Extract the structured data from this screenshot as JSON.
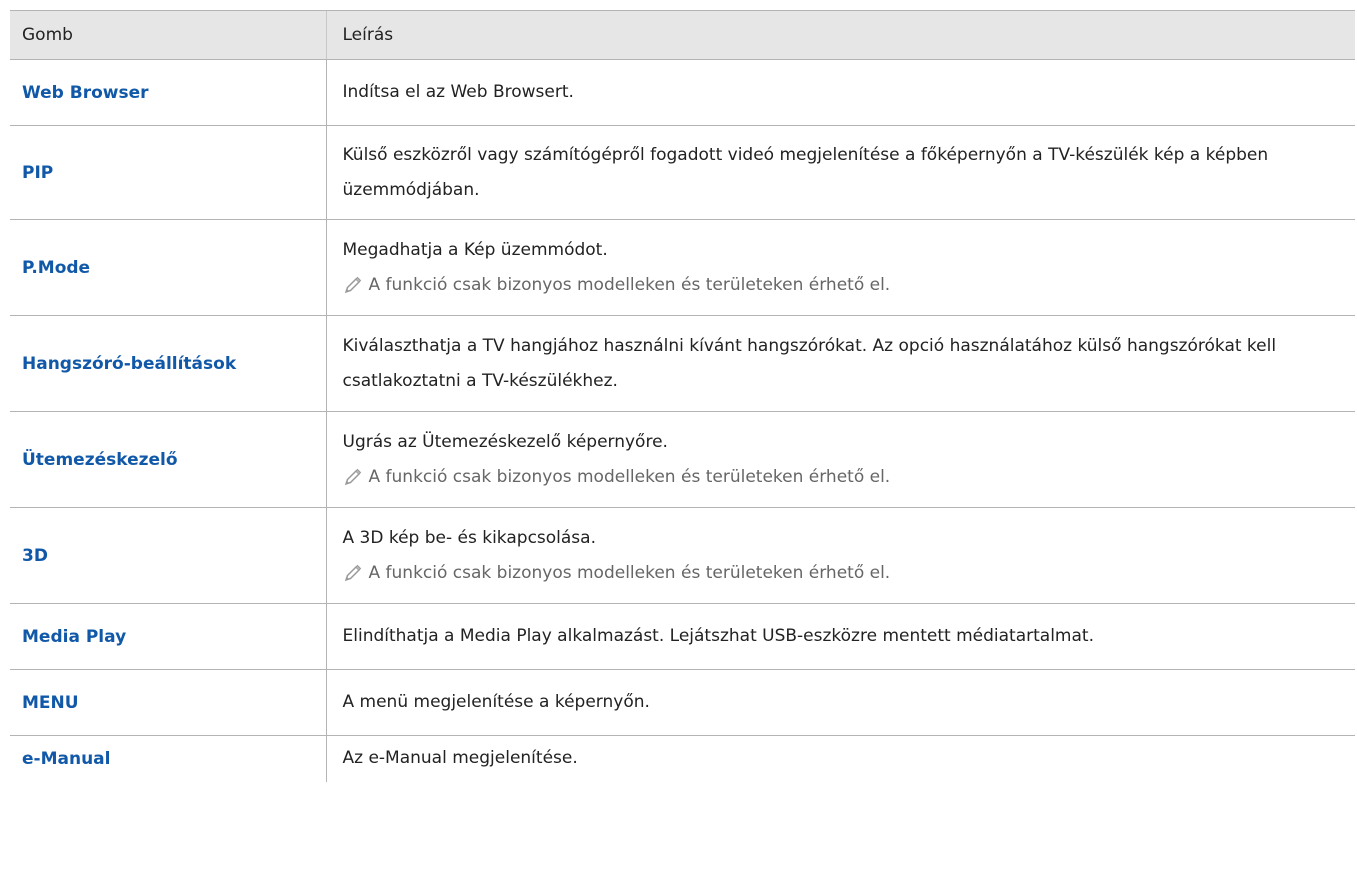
{
  "table": {
    "headers": [
      "Gomb",
      "Leírás"
    ],
    "rows": [
      {
        "button": "Web Browser",
        "desc": "Indítsa el az Web Browsert.",
        "note": ""
      },
      {
        "button": "PIP",
        "desc": "Külső eszközről vagy számítógépről fogadott videó megjelenítése a főképernyőn a TV-készülék kép a képben üzemmódjában.",
        "note": ""
      },
      {
        "button": "P.Mode",
        "desc": "Megadhatja a Kép üzemmódot.",
        "note": "A funkció csak bizonyos modelleken és területeken érhető el."
      },
      {
        "button": "Hangszóró-beállítások",
        "desc": "Kiválaszthatja a TV hangjához használni kívánt hangszórókat. Az opció használatához külső hangszórókat kell csatlakoztatni a TV-készülékhez.",
        "note": ""
      },
      {
        "button": "Ütemezéskezelő",
        "desc": "Ugrás az Ütemezéskezelő képernyőre.",
        "note": "A funkció csak bizonyos modelleken és területeken érhető el."
      },
      {
        "button": "3D",
        "desc": "A 3D kép be- és kikapcsolása.",
        "note": "A funkció csak bizonyos modelleken és területeken érhető el."
      },
      {
        "button": "Media Play",
        "desc": "Elindíthatja a Media Play alkalmazást. Lejátszhat USB-eszközre mentett médiatartalmat.",
        "note": ""
      },
      {
        "button": "MENU",
        "desc": "A menü megjelenítése a képernyőn.",
        "note": ""
      },
      {
        "button": "e-Manual",
        "desc": "Az e-Manual megjelenítése.",
        "note": ""
      }
    ]
  },
  "colors": {
    "link": "#1159a8",
    "header_bg": "#e6e6e6",
    "note": "#666666"
  }
}
